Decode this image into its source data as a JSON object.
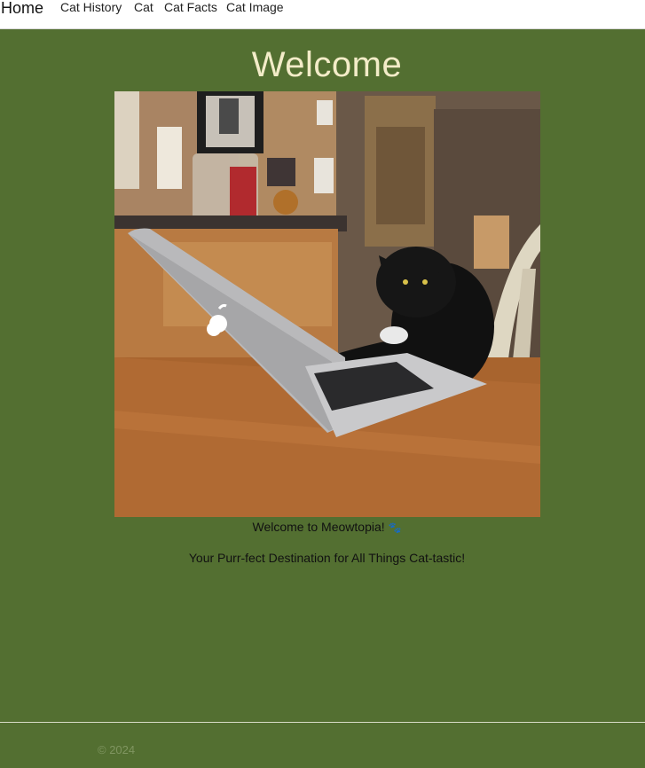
{
  "navbar": {
    "brand": "Home",
    "links": [
      "Cat History",
      "Cat",
      "Cat Facts",
      "Cat Image"
    ]
  },
  "main": {
    "title": "Welcome",
    "image_description_icon": "cat-typing-on-laptop-image",
    "welcome_text": "Welcome to Meowtopia!",
    "welcome_emoji": "🐾",
    "tagline": "Your Purr-fect Destination for All Things Cat-tastic!"
  },
  "footer": {
    "copyright": "© 2024"
  },
  "colors": {
    "background": "#536f31",
    "title": "#f3ecc8",
    "navbar": "#ffffff"
  }
}
